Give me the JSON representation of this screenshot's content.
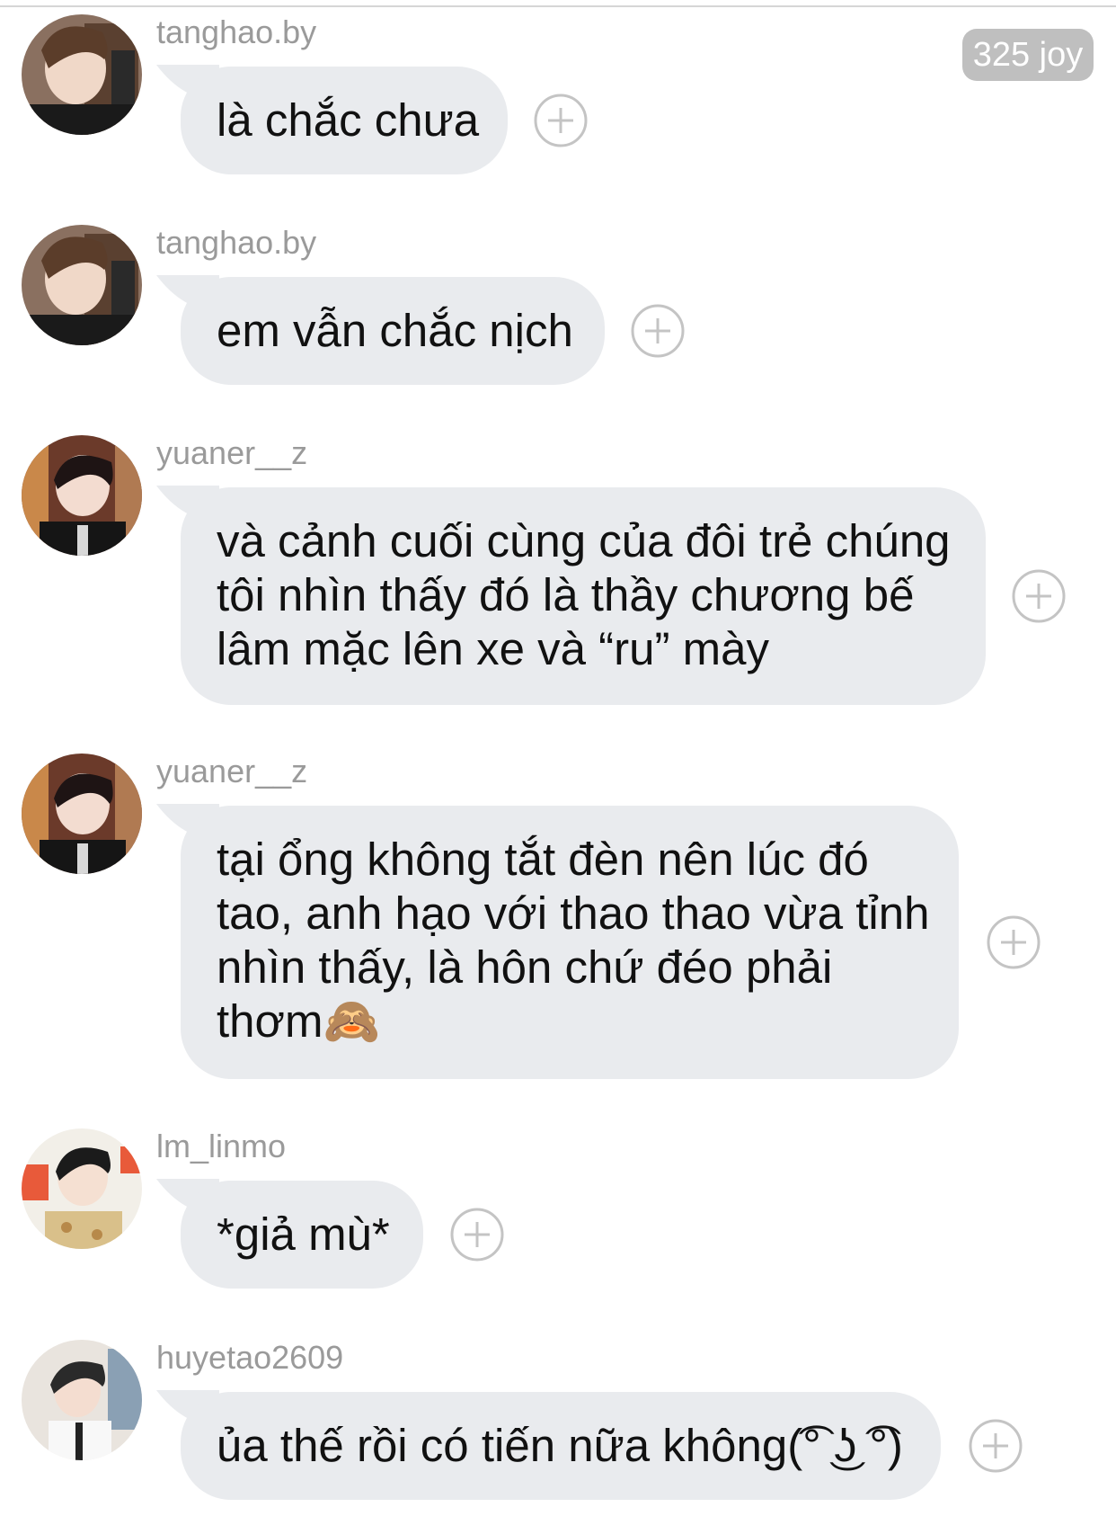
{
  "header": {
    "joy_badge": "325 joy"
  },
  "colors": {
    "bubble": "#e9ebee",
    "username": "#9a9a9a",
    "badge": "#bfbfbf",
    "plus": "#c4c4c4"
  },
  "messages": [
    {
      "username": "tanghao.by",
      "avatar": "avatar-tanghao",
      "lines": [
        "là chắc chưa"
      ]
    },
    {
      "username": "tanghao.by",
      "avatar": "avatar-tanghao",
      "lines": [
        "em vẫn chắc nịch"
      ]
    },
    {
      "username": "yuaner__z",
      "avatar": "avatar-yuaner",
      "lines": [
        "và cảnh cuối cùng của đôi trẻ chúng",
        "tôi nhìn thấy đó là thầy chương bế",
        "lâm mặc lên xe và “ru” mày"
      ]
    },
    {
      "username": "yuaner__z",
      "avatar": "avatar-yuaner",
      "lines": [
        "tại ổng không tắt đèn nên lúc đó",
        "tao, anh hạo với thao thao vừa tỉnh",
        "nhìn thấy, là hôn chứ đéo phải",
        "thơm🙈"
      ]
    },
    {
      "username": "lm_linmo",
      "avatar": "avatar-linmo",
      "lines": [
        "*giả mù*"
      ]
    },
    {
      "username": "huyetao2609",
      "avatar": "avatar-huyetao",
      "lines": [
        "ủa thế rồi có tiến nữa không(͡° ͜ʖ ͡°)"
      ]
    }
  ]
}
